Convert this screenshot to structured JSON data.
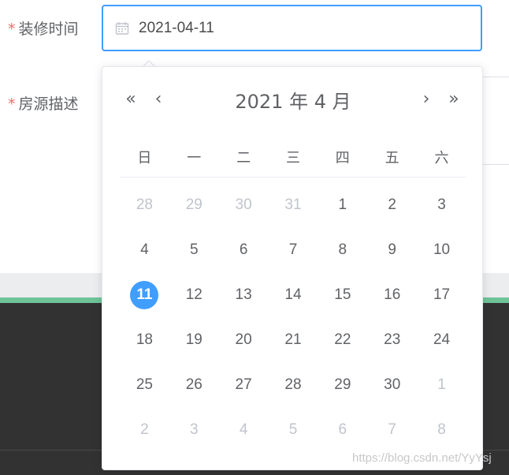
{
  "form": {
    "labels": [
      {
        "required": "*",
        "text": "装修时间"
      },
      {
        "required": "*",
        "text": "房源描述"
      }
    ],
    "date_input": {
      "value": "2021-04-11",
      "icon": "calendar-icon"
    }
  },
  "picker": {
    "title": "2021 年  4 月",
    "nav": {
      "prev_year": "«",
      "prev_month": "‹",
      "next_month": "›",
      "next_year": "»"
    },
    "weekdays": [
      "日",
      "一",
      "二",
      "三",
      "四",
      "五",
      "六"
    ],
    "weeks": [
      [
        {
          "d": "28",
          "m": "prev"
        },
        {
          "d": "29",
          "m": "prev"
        },
        {
          "d": "30",
          "m": "prev"
        },
        {
          "d": "31",
          "m": "prev"
        },
        {
          "d": "1",
          "m": "cur"
        },
        {
          "d": "2",
          "m": "cur"
        },
        {
          "d": "3",
          "m": "cur"
        }
      ],
      [
        {
          "d": "4",
          "m": "cur"
        },
        {
          "d": "5",
          "m": "cur"
        },
        {
          "d": "6",
          "m": "cur"
        },
        {
          "d": "7",
          "m": "cur"
        },
        {
          "d": "8",
          "m": "cur"
        },
        {
          "d": "9",
          "m": "cur"
        },
        {
          "d": "10",
          "m": "cur"
        }
      ],
      [
        {
          "d": "11",
          "m": "cur",
          "selected": true
        },
        {
          "d": "12",
          "m": "cur"
        },
        {
          "d": "13",
          "m": "cur"
        },
        {
          "d": "14",
          "m": "cur"
        },
        {
          "d": "15",
          "m": "cur"
        },
        {
          "d": "16",
          "m": "cur"
        },
        {
          "d": "17",
          "m": "cur"
        }
      ],
      [
        {
          "d": "18",
          "m": "cur"
        },
        {
          "d": "19",
          "m": "cur"
        },
        {
          "d": "20",
          "m": "cur"
        },
        {
          "d": "21",
          "m": "cur"
        },
        {
          "d": "22",
          "m": "cur"
        },
        {
          "d": "23",
          "m": "cur"
        },
        {
          "d": "24",
          "m": "cur"
        }
      ],
      [
        {
          "d": "25",
          "m": "cur"
        },
        {
          "d": "26",
          "m": "cur"
        },
        {
          "d": "27",
          "m": "cur"
        },
        {
          "d": "28",
          "m": "cur"
        },
        {
          "d": "29",
          "m": "cur"
        },
        {
          "d": "30",
          "m": "cur"
        },
        {
          "d": "1",
          "m": "next"
        }
      ],
      [
        {
          "d": "2",
          "m": "next"
        },
        {
          "d": "3",
          "m": "next"
        },
        {
          "d": "4",
          "m": "next"
        },
        {
          "d": "5",
          "m": "next"
        },
        {
          "d": "6",
          "m": "next"
        },
        {
          "d": "7",
          "m": "next"
        },
        {
          "d": "8",
          "m": "next"
        }
      ]
    ]
  },
  "colors": {
    "accent": "#409eff",
    "required": "#f56c6c",
    "muted": "#c0c4cc"
  },
  "watermark": "https://blog.csdn.net/YyYsj"
}
